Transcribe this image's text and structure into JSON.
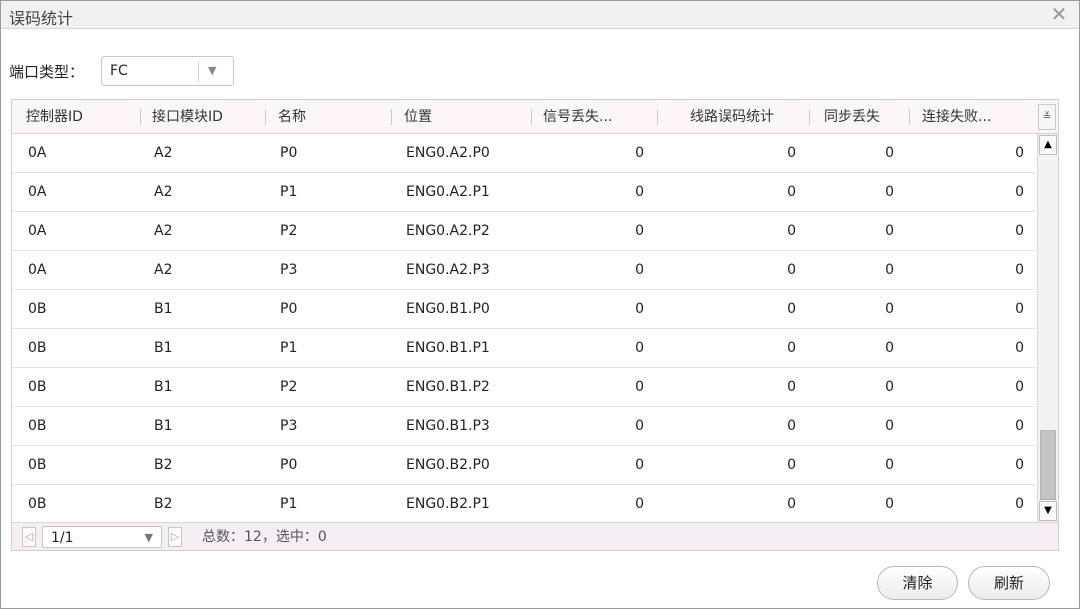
{
  "window": {
    "title": "误码统计"
  },
  "filter": {
    "label": "端口类型：",
    "value": "FC"
  },
  "table": {
    "headers": [
      "控制器ID",
      "接口模块ID",
      "名称",
      "位置",
      "信号丢失...",
      "线路误码统计",
      "同步丢失",
      "连接失败..."
    ],
    "rows": [
      [
        "0A",
        "A2",
        "P0",
        "ENG0.A2.P0",
        "0",
        "0",
        "0",
        "0"
      ],
      [
        "0A",
        "A2",
        "P1",
        "ENG0.A2.P1",
        "0",
        "0",
        "0",
        "0"
      ],
      [
        "0A",
        "A2",
        "P2",
        "ENG0.A2.P2",
        "0",
        "0",
        "0",
        "0"
      ],
      [
        "0A",
        "A2",
        "P3",
        "ENG0.A2.P3",
        "0",
        "0",
        "0",
        "0"
      ],
      [
        "0B",
        "B1",
        "P0",
        "ENG0.B1.P0",
        "0",
        "0",
        "0",
        "0"
      ],
      [
        "0B",
        "B1",
        "P1",
        "ENG0.B1.P1",
        "0",
        "0",
        "0",
        "0"
      ],
      [
        "0B",
        "B1",
        "P2",
        "ENG0.B1.P2",
        "0",
        "0",
        "0",
        "0"
      ],
      [
        "0B",
        "B1",
        "P3",
        "ENG0.B1.P3",
        "0",
        "0",
        "0",
        "0"
      ],
      [
        "0B",
        "B2",
        "P0",
        "ENG0.B2.P0",
        "0",
        "0",
        "0",
        "0"
      ],
      [
        "0B",
        "B2",
        "P1",
        "ENG0.B2.P1",
        "0",
        "0",
        "0",
        "0"
      ]
    ]
  },
  "pager": {
    "page": "1/1",
    "summary": "总数：12，选中：0"
  },
  "buttons": {
    "clear": "清除",
    "refresh": "刷新"
  },
  "icons": {
    "close": "close-icon",
    "dropdown": "chevron-down-icon",
    "column_menu": "double-chevron-down-icon"
  }
}
